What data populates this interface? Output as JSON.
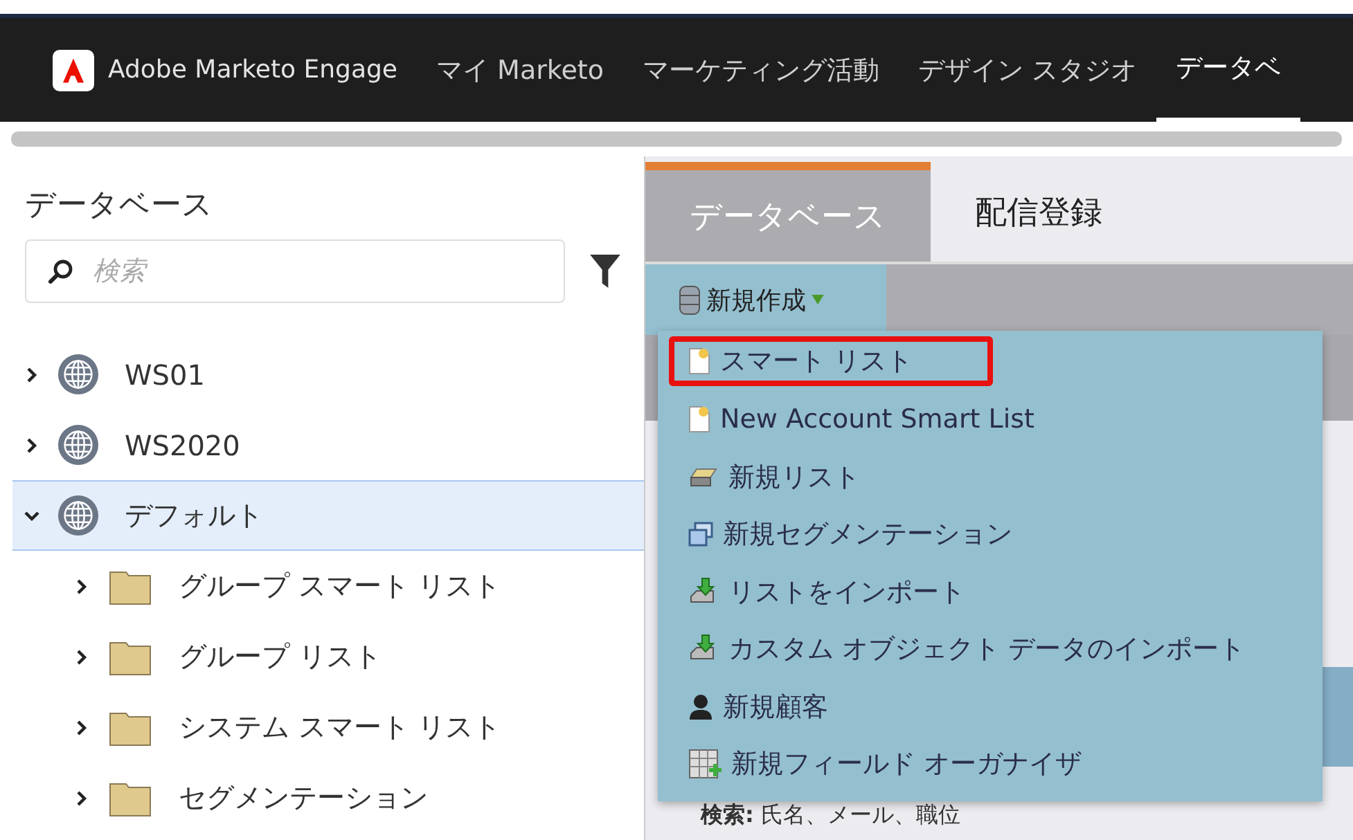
{
  "nav": {
    "brand": "Adobe Marketo Engage",
    "items": [
      {
        "label": "マイ Marketo",
        "selected": false
      },
      {
        "label": "マーケティング活動",
        "selected": false
      },
      {
        "label": "デザイン スタジオ",
        "selected": false
      },
      {
        "label": "データベ",
        "selected": true
      }
    ]
  },
  "sidebar": {
    "title": "データベース",
    "search": {
      "placeholder": "検索"
    },
    "tree": [
      {
        "label": "WS01",
        "kind": "workspace",
        "expanded": false,
        "selected": false
      },
      {
        "label": "WS2020",
        "kind": "workspace",
        "expanded": false,
        "selected": false
      },
      {
        "label": "デフォルト",
        "kind": "workspace",
        "expanded": true,
        "selected": true,
        "children": [
          {
            "label": "グループ スマート リスト",
            "kind": "folder",
            "expanded": false,
            "selected": false
          },
          {
            "label": "グループ リスト",
            "kind": "folder",
            "expanded": false,
            "selected": false
          },
          {
            "label": "システム スマート リスト",
            "kind": "folder",
            "expanded": false,
            "selected": false
          },
          {
            "label": "セグメンテーション",
            "kind": "folder",
            "expanded": false,
            "selected": false
          }
        ]
      }
    ]
  },
  "tabs": [
    {
      "label": "データベース",
      "selected": true
    },
    {
      "label": "配信登録",
      "selected": false
    }
  ],
  "toolbar": {
    "new_button": "新規作成"
  },
  "menu": [
    {
      "label": "スマート リスト",
      "kind": "smartlist",
      "highlighted": true
    },
    {
      "label": "New Account Smart List",
      "kind": "smartlist",
      "highlighted": false
    },
    {
      "label": "新規リスト",
      "kind": "list",
      "highlighted": false
    },
    {
      "label": "新規セグメンテーション",
      "kind": "segmentation",
      "highlighted": false
    },
    {
      "label": "リストをインポート",
      "kind": "import",
      "highlighted": false
    },
    {
      "label": "カスタム オブジェクト データのインポート",
      "kind": "import",
      "highlighted": false
    },
    {
      "label": "新規顧客",
      "kind": "person",
      "highlighted": false
    },
    {
      "label": "新規フィールド オーガナイザ",
      "kind": "fields",
      "highlighted": false
    }
  ],
  "help_text": "**検索:** 氏名、メール、職位"
}
